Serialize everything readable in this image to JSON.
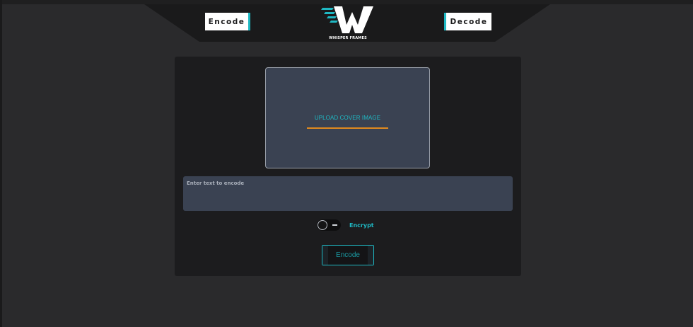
{
  "header": {
    "encode_label": "Encode",
    "decode_label": "Decode",
    "logo_text": "WHISPER FRAMES",
    "accent_color": "#1fb8c3",
    "header_bg": "#1a1a1b"
  },
  "upload": {
    "label": "UPLOAD COVER IMAGE",
    "underline_color": "#e08a1e"
  },
  "message": {
    "placeholder": "Enter text to encode",
    "value": ""
  },
  "encrypt": {
    "label": "Encrypt",
    "enabled": false
  },
  "action": {
    "encode_label": "Encode"
  }
}
